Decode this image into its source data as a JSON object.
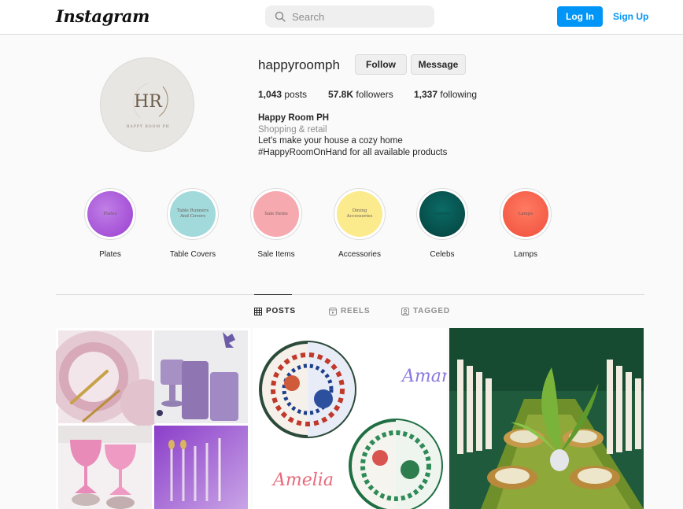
{
  "header": {
    "logo": "Instagram",
    "search_placeholder": "Search",
    "login_label": "Log In",
    "signup_label": "Sign Up"
  },
  "profile": {
    "username": "happyroomph",
    "follow_label": "Follow",
    "message_label": "Message",
    "avatar_text": "HR",
    "avatar_subtext": "HAPPY ROOM PH",
    "stats": {
      "posts_count": "1,043",
      "posts_label": "posts",
      "followers_count": "57.8K",
      "followers_label": "followers",
      "following_count": "1,337",
      "following_label": "following"
    },
    "bio": {
      "name": "Happy Room PH",
      "category": "Shopping & retail",
      "line1": "Let's make your house a cozy home",
      "line2": "#HappyRoomOnHand for all available products"
    }
  },
  "highlights": [
    {
      "label": "Plates",
      "cover_text": "Plates",
      "color": "#a64fd8"
    },
    {
      "label": "Table Covers",
      "cover_text": "Table Runners And Covers",
      "color": "#a2d9db"
    },
    {
      "label": "Sale Items",
      "cover_text": "Sale Items",
      "color": "#f6a9ae"
    },
    {
      "label": "Accessories",
      "cover_text": "Dining Accessories",
      "color": "#fbeb8c"
    },
    {
      "label": "Celebs",
      "cover_text": "Celebs",
      "color": "#06534f"
    },
    {
      "label": "Lamps",
      "cover_text": "Lamps",
      "color": "#f86250"
    }
  ],
  "tabs": [
    {
      "label": "POSTS",
      "icon": "grid-icon",
      "active": true
    },
    {
      "label": "REELS",
      "icon": "reels-icon",
      "active": false
    },
    {
      "label": "TAGGED",
      "icon": "tagged-icon",
      "active": false
    }
  ],
  "posts": {
    "post2_script_1": "Amanda",
    "post2_script_2": "Amelia"
  },
  "colors": {
    "accent": "#0095f6",
    "border": "#dbdbdb",
    "text": "#262626",
    "muted": "#8e8e8e"
  }
}
